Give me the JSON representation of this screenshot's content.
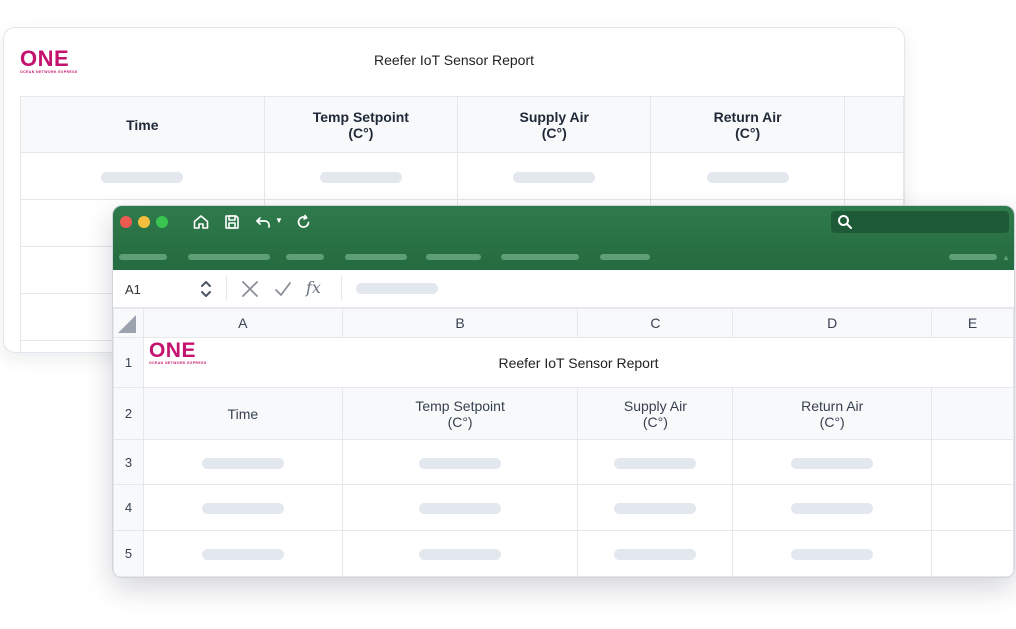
{
  "report": {
    "logo": {
      "text": "ONE",
      "tagline": "OCEAN NETWORK EXPRESS"
    },
    "title": "Reefer IoT Sensor Report",
    "headers": [
      {
        "line1": "Time",
        "line2": ""
      },
      {
        "line1": "Temp Setpoint",
        "line2": "(C°)"
      },
      {
        "line1": "Supply Air",
        "line2": "(C°)"
      },
      {
        "line1": "Return Air",
        "line2": "(C°)"
      },
      {
        "line1": "",
        "line2": ""
      }
    ]
  },
  "excel": {
    "name_box": "A1",
    "formula_icon": "fx",
    "icons": {
      "home": "home-icon",
      "save": "save-icon",
      "undo": "undo-icon",
      "redo": "redo-icon",
      "search": "search-icon",
      "cancel": "cancel-icon",
      "confirm": "checkmark-icon"
    },
    "colors": {
      "ribbon": "#2f7a4c",
      "brand": "#c4136e",
      "close": "#ef5b52",
      "minimize": "#f4bf3d",
      "maximize": "#39c451"
    },
    "columns": [
      "A",
      "B",
      "C",
      "D",
      "E"
    ],
    "rows": [
      "1",
      "2",
      "3",
      "4",
      "5"
    ],
    "sheet": {
      "logo": {
        "text": "ONE",
        "tagline": "OCEAN NETWORK EXPRESS"
      },
      "title": "Reefer IoT Sensor Report",
      "headers": [
        {
          "line1": "Time",
          "line2": ""
        },
        {
          "line1": "Temp Setpoint",
          "line2": "(C°)"
        },
        {
          "line1": "Supply Air",
          "line2": "(C°)"
        },
        {
          "line1": "Return Air",
          "line2": "(C°)"
        }
      ]
    }
  }
}
